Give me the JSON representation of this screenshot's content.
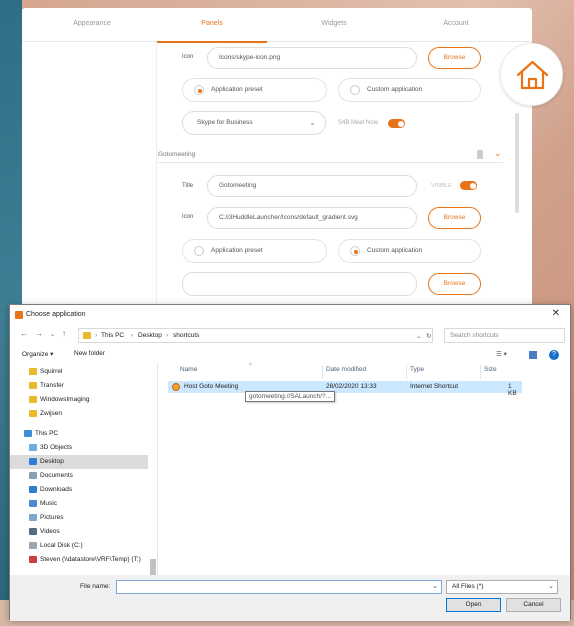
{
  "settings": {
    "tabs": [
      "Appearance",
      "Panels",
      "Widgets",
      "Account"
    ],
    "skype": {
      "icon_label": "Icon",
      "icon_value": "Icons/skype-icon.png",
      "browse_label": "Browse",
      "radio_preset": "Application preset",
      "radio_custom": "Custom application",
      "preset_value": "Skype for Business",
      "toggle_label": "S4B Meet Now"
    },
    "section_title": "Gotomeeting",
    "goto": {
      "title_label": "Title",
      "title_value": "Gotomeeting",
      "visible_label": "VISIBLE",
      "icon_label": "Icon",
      "icon_value": "C:/i3HuddleLauncher/Icons/default_gradient.svg",
      "browse_label": "Browse",
      "radio_preset": "Application preset",
      "radio_custom": "Custom application",
      "path_value": "",
      "browse2_label": "Browse"
    },
    "accent_color": "#e8741a"
  },
  "dialog": {
    "title": "Choose application",
    "breadcrumbs": [
      "This PC",
      "Desktop",
      "shortcuts"
    ],
    "search_placeholder": "Search shortcuts",
    "organize": "Organize ▾",
    "new_folder": "New folder",
    "tree": [
      "Squirrel",
      "Transfer",
      "WindowsImaging",
      "Zwijsen",
      "This PC",
      "3D Objects",
      "Desktop",
      "Documents",
      "Downloads",
      "Music",
      "Pictures",
      "Videos",
      "Local Disk (C:)",
      "Steven (\\\\datastore\\VRF\\Temp) (T:)"
    ],
    "columns": [
      "Name",
      "Date modified",
      "Type",
      "Size"
    ],
    "files": [
      {
        "name": "Host Goto Meeting",
        "date": "28/02/2020 13:33",
        "type": "Internet Shortcut",
        "size": "1 KB"
      }
    ],
    "tooltip": "gotomeeting://SALaunch/?...",
    "file_name_label": "File name:",
    "file_name_value": "",
    "file_type": "All Files  (*)",
    "open_label": "Open",
    "cancel_label": "Cancel"
  }
}
